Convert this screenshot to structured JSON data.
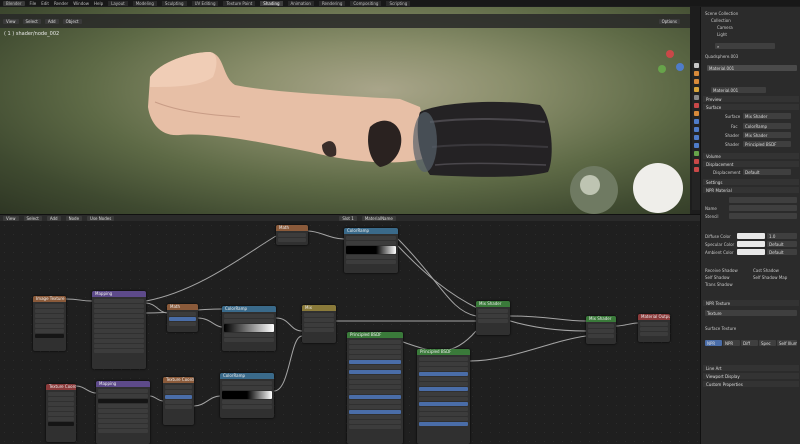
{
  "topbar": {
    "menus": [
      "Blender",
      "File",
      "Edit",
      "Render",
      "Window",
      "Help"
    ],
    "tabs": [
      "Layout",
      "Modeling",
      "Sculpting",
      "UV Editing",
      "Texture Paint",
      "Shading",
      "Animation",
      "Rendering",
      "Compositing",
      "Scripting"
    ],
    "active_tab": "Shading"
  },
  "viewport": {
    "header_buttons": [
      "View",
      "Select",
      "Add",
      "Object"
    ],
    "label": "( 1 ) shader/node_002",
    "options": "Options"
  },
  "node_editor": {
    "header_buttons": [
      "View",
      "Select",
      "Add",
      "Node",
      "Use Nodes"
    ],
    "slot": "Slot 1",
    "material": "MaterialName"
  },
  "properties": {
    "scene_collection": "Scene Collection",
    "collection": "Collection",
    "items": [
      "Camera",
      "Light"
    ],
    "object": "Quadsphere.003",
    "material_slot": "Material.001",
    "sections": [
      "Preview",
      "Surface",
      "Volume",
      "Displacement",
      "Settings",
      "Line Art"
    ],
    "surface": {
      "label": "Surface",
      "value": "Mix Shader"
    },
    "fac": {
      "label": "Fac",
      "value": "ColorRamp"
    },
    "shader1": {
      "label": "Shader",
      "value": "Mix Shader"
    },
    "shader2": {
      "label": "Shader",
      "value": "Principled BSDF"
    },
    "displacement_method": {
      "label": "Displacement",
      "value": "Default"
    },
    "npr_title": "NPR Material",
    "fields": [
      "Name",
      "Stencil",
      "Name",
      "Specular"
    ],
    "diffuse": {
      "label": "Diffuse Color",
      "value": "1.0"
    },
    "specular": {
      "label": "Specular Color",
      "value": "Default"
    },
    "ambient": {
      "label": "Ambient Color",
      "value": "Default"
    },
    "shadow": {
      "opt1": "Receive Shadow",
      "opt2": "Cast Shadow",
      "opt3": "Self Shadow",
      "opt4": "Self Shadow Map",
      "opt5": "Trans Shadow"
    },
    "npr_texture": "NPR Texture",
    "texture_slot": "Texture",
    "surface_title": "Surface Texture",
    "tex_tabs": [
      "NPR",
      "NPR",
      "Diff",
      "Spec",
      "Self Illum."
    ],
    "bottom": [
      "Line Art",
      "Viewport Display",
      "Custom Properties"
    ]
  },
  "nodes": [
    {
      "title": "Image Texture",
      "color": "#8a5a3a"
    },
    {
      "title": "Texture Coordinate",
      "color": "#8a3a3a"
    },
    {
      "title": "Mapping",
      "color": "#5d4a8a"
    },
    {
      "title": "Math",
      "color": "#8a5a3a"
    },
    {
      "title": "ColorRamp",
      "color": "#3a6a8a"
    },
    {
      "title": "Principled BSDF",
      "color": "#3a7a3a"
    },
    {
      "title": "Mix Shader",
      "color": "#3a7a3a"
    },
    {
      "title": "Material Output",
      "color": "#8a3a3a"
    },
    {
      "title": "Mix",
      "color": "#8a7a3a"
    },
    {
      "title": "Texture Coordinate",
      "color": "#8a3a3a"
    },
    {
      "title": "Mapping",
      "color": "#5d4a8a"
    },
    {
      "title": "Math",
      "color": "#8a5a3a"
    },
    {
      "title": "ColorRamp",
      "color": "#3a6a8a"
    },
    {
      "title": "Principled BSDF",
      "color": "#3a7a3a"
    },
    {
      "title": "Mix Shader",
      "color": "#3a7a3a"
    },
    {
      "title": "ColorRamp",
      "color": "#3a6a8a"
    }
  ]
}
